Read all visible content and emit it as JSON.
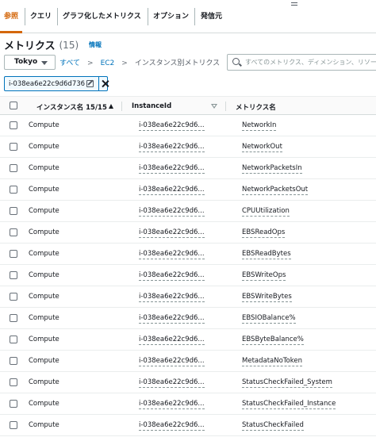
{
  "tabs": [
    {
      "label": "参照",
      "active": true
    },
    {
      "label": "クエリ",
      "active": false
    },
    {
      "label": "グラフ化したメトリクス",
      "active": false
    },
    {
      "label": "オプション",
      "active": false
    },
    {
      "label": "発信元",
      "active": false
    }
  ],
  "header": {
    "title": "メトリクス",
    "count": "(15)",
    "info_link": "情報"
  },
  "region": {
    "selected": "Tokyo"
  },
  "breadcrumb": {
    "items": [
      "すべて",
      "EC2",
      "インスタンス別メトリクス"
    ]
  },
  "search": {
    "placeholder": "すべてのメトリクス、ディメンション、リソース ID を検索"
  },
  "filter_token": {
    "label": "i-038ea6e22c9d6d736"
  },
  "table": {
    "columns": [
      "インスタンス名 15/15",
      "InstanceId",
      "メトリクス名"
    ],
    "rows": [
      {
        "name": "Compute",
        "instance_id": "i-038ea6e22c9d6...",
        "metric": "NetworkIn"
      },
      {
        "name": "Compute",
        "instance_id": "i-038ea6e22c9d6...",
        "metric": "NetworkOut"
      },
      {
        "name": "Compute",
        "instance_id": "i-038ea6e22c9d6...",
        "metric": "NetworkPacketsIn"
      },
      {
        "name": "Compute",
        "instance_id": "i-038ea6e22c9d6...",
        "metric": "NetworkPacketsOut"
      },
      {
        "name": "Compute",
        "instance_id": "i-038ea6e22c9d6...",
        "metric": "CPUUtilization"
      },
      {
        "name": "Compute",
        "instance_id": "i-038ea6e22c9d6...",
        "metric": "EBSReadOps"
      },
      {
        "name": "Compute",
        "instance_id": "i-038ea6e22c9d6...",
        "metric": "EBSReadBytes"
      },
      {
        "name": "Compute",
        "instance_id": "i-038ea6e22c9d6...",
        "metric": "EBSWriteOps"
      },
      {
        "name": "Compute",
        "instance_id": "i-038ea6e22c9d6...",
        "metric": "EBSWriteBytes"
      },
      {
        "name": "Compute",
        "instance_id": "i-038ea6e22c9d6...",
        "metric": "EBSIOBalance%"
      },
      {
        "name": "Compute",
        "instance_id": "i-038ea6e22c9d6...",
        "metric": "EBSByteBalance%"
      },
      {
        "name": "Compute",
        "instance_id": "i-038ea6e22c9d6...",
        "metric": "MetadataNoToken"
      },
      {
        "name": "Compute",
        "instance_id": "i-038ea6e22c9d6...",
        "metric": "StatusCheckFailed_System"
      },
      {
        "name": "Compute",
        "instance_id": "i-038ea6e22c9d6...",
        "metric": "StatusCheckFailed_Instance"
      },
      {
        "name": "Compute",
        "instance_id": "i-038ea6e22c9d6...",
        "metric": "StatusCheckFailed"
      }
    ]
  },
  "colors": {
    "accent": "#d4670a",
    "link": "#0073bb",
    "text": "#16191f"
  }
}
